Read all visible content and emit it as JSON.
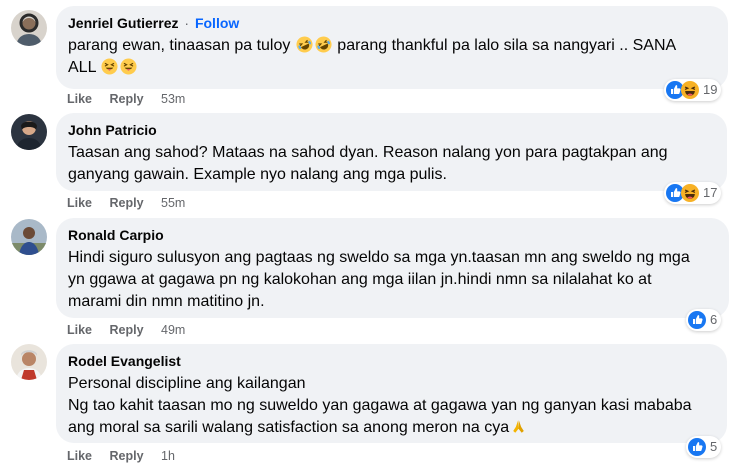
{
  "comments": [
    {
      "name": "Jenriel Gutierrez",
      "follow": "Follow",
      "separator": "·",
      "lines": [
        "parang ewan, tinaasan pa tuloy 🤣🤣 parang thankful pa lalo sila sa nangyari .. SANA",
        "ALL 😝😝"
      ],
      "like": "Like",
      "reply": "Reply",
      "time": "53m",
      "reaction_count": "19",
      "reaction_icons": [
        "like-icon",
        "haha-icon"
      ]
    },
    {
      "name": "John Patricio",
      "lines": [
        "Taasan ang sahod? Mataas na sahod dyan. Reason nalang yon para pagtakpan ang",
        "ganyang gawain. Example nyo nalang ang mga pulis."
      ],
      "like": "Like",
      "reply": "Reply",
      "time": "55m",
      "reaction_count": "17",
      "reaction_icons": [
        "like-icon",
        "haha-icon"
      ]
    },
    {
      "name": "Ronald Carpio",
      "lines": [
        "Hindi siguro sulusyon ang pagtaas ng sweldo sa mga yn.taasan mn ang sweldo ng mga",
        "yn ggawa at gagawa pn ng kalokohan ang mga iilan jn.hindi nmn sa nilalahat ko at",
        "marami din nmn matitino jn."
      ],
      "like": "Like",
      "reply": "Reply",
      "time": "49m",
      "reaction_count": "6",
      "reaction_icons": [
        "like-icon"
      ]
    },
    {
      "name": "Rodel Evangelist",
      "lines": [
        "Personal discipline ang kailangan",
        "Ng tao kahit taasan mo ng suweldo yan gagawa at gagawa yan ng ganyan kasi mababa",
        "ang moral sa sarili walang satisfaction sa anong meron na cya🙏"
      ],
      "like": "Like",
      "reply": "Reply",
      "time": "1h",
      "reaction_count": "5",
      "reaction_icons": [
        "like-icon"
      ]
    }
  ],
  "colors": {
    "bubble": "#f0f2f5",
    "follow": "#0866ff",
    "muted": "#65676b",
    "like_reaction": "#1877f2",
    "haha_reaction": "#f7b125"
  }
}
